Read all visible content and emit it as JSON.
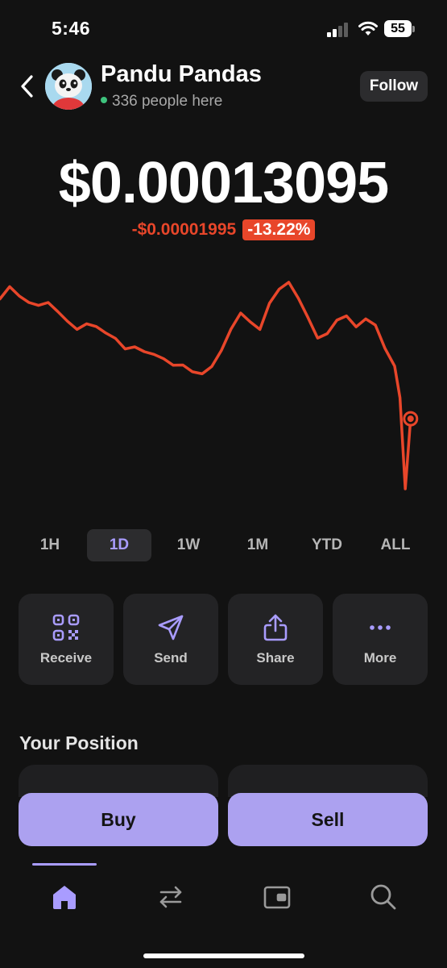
{
  "status_bar": {
    "time": "5:46",
    "battery": "55"
  },
  "header": {
    "title": "Pandu Pandas",
    "presence": "336 people here",
    "follow_label": "Follow"
  },
  "price": {
    "value": "$0.00013095",
    "change": "-$0.00001995",
    "change_pct": "-13.22%"
  },
  "colors": {
    "accent": "#a99cff",
    "negative": "#e8462a",
    "buy_sell_bg": "#aca1f0"
  },
  "chart_data": {
    "type": "line",
    "series": [
      {
        "values": [
          0.0001454,
          0.0001472,
          0.0001461,
          0.000145,
          0.0001443,
          0.0001446,
          0.0001438,
          0.000143,
          0.0001421,
          0.0001425,
          0.0001418,
          0.0001409,
          0.0001405,
          0.0001396,
          0.00014,
          0.0001392,
          0.0001385,
          0.0001378,
          0.0001372,
          0.0001376,
          0.000137,
          0.0001366,
          0.0001371,
          0.0001388,
          0.0001415,
          0.0001438,
          0.000143,
          0.000142,
          0.0001448,
          0.0001462,
          0.0001471,
          0.0001455,
          0.0001435,
          0.000141,
          0.0001412,
          0.0001425,
          0.000143,
          0.000142,
          0.0001433,
          0.0001426,
          0.0001395,
          0.000137,
          0.0001335,
          0.0001225,
          0.00013095
        ]
      }
    ],
    "ranges": [
      "1H",
      "1D",
      "1W",
      "1M",
      "YTD",
      "ALL"
    ],
    "selected_range": "1D"
  },
  "actions": {
    "receive": "Receive",
    "send": "Send",
    "share": "Share",
    "more": "More"
  },
  "position": {
    "title": "Your Position"
  },
  "trade": {
    "buy": "Buy",
    "sell": "Sell"
  },
  "tabs": [
    "home-icon",
    "swap-icon",
    "wallet-icon",
    "search-icon"
  ]
}
